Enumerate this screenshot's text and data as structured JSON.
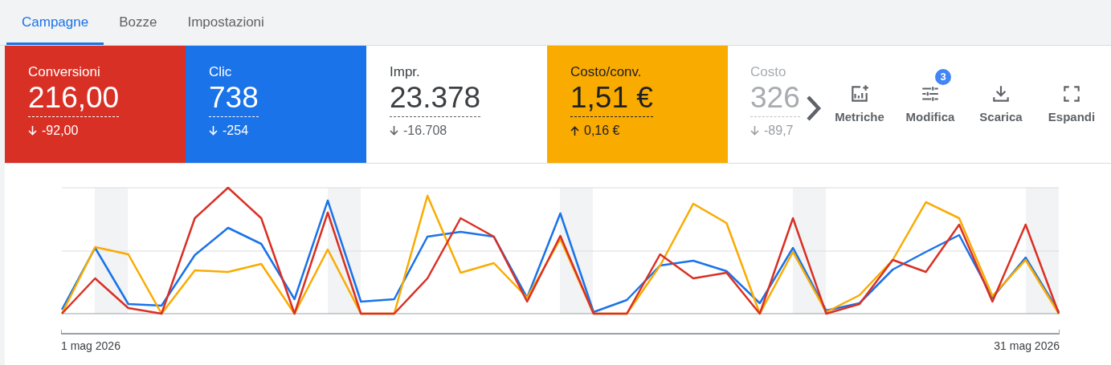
{
  "tabs": [
    {
      "label": "Campagne",
      "selected": true
    },
    {
      "label": "Bozze",
      "selected": false
    },
    {
      "label": "Impostazioni",
      "selected": false
    }
  ],
  "scorecards": [
    {
      "kind": "metric",
      "label": "Conversioni",
      "value": "216,00",
      "change": "-92,00",
      "increase": false,
      "color": "#d93025"
    },
    {
      "kind": "metric",
      "label": "Clic",
      "value": "738",
      "change": "-254",
      "increase": false,
      "color": "#1a73e8"
    },
    {
      "kind": "metric",
      "label": "Impr.",
      "value": "23.378",
      "change": "-16.708",
      "increase": false
    },
    {
      "kind": "metric",
      "label": "Costo/conv.",
      "value": "1,51 €",
      "change": "0,16 €",
      "increase": true,
      "color": "#f9ab00"
    },
    {
      "kind": "partial",
      "label": "Costo",
      "value": "326",
      "change": "-89,7",
      "increase": false
    }
  ],
  "toolbar": [
    {
      "kind": "metrics",
      "label": "Metriche"
    },
    {
      "kind": "adjust",
      "label": "Modifica",
      "badge": "3"
    },
    {
      "kind": "download",
      "label": "Scarica"
    },
    {
      "kind": "expand",
      "label": "Espandi"
    }
  ],
  "chart": {
    "start_label": "1 mag 2026",
    "end_label": "31 mag 2026"
  }
}
